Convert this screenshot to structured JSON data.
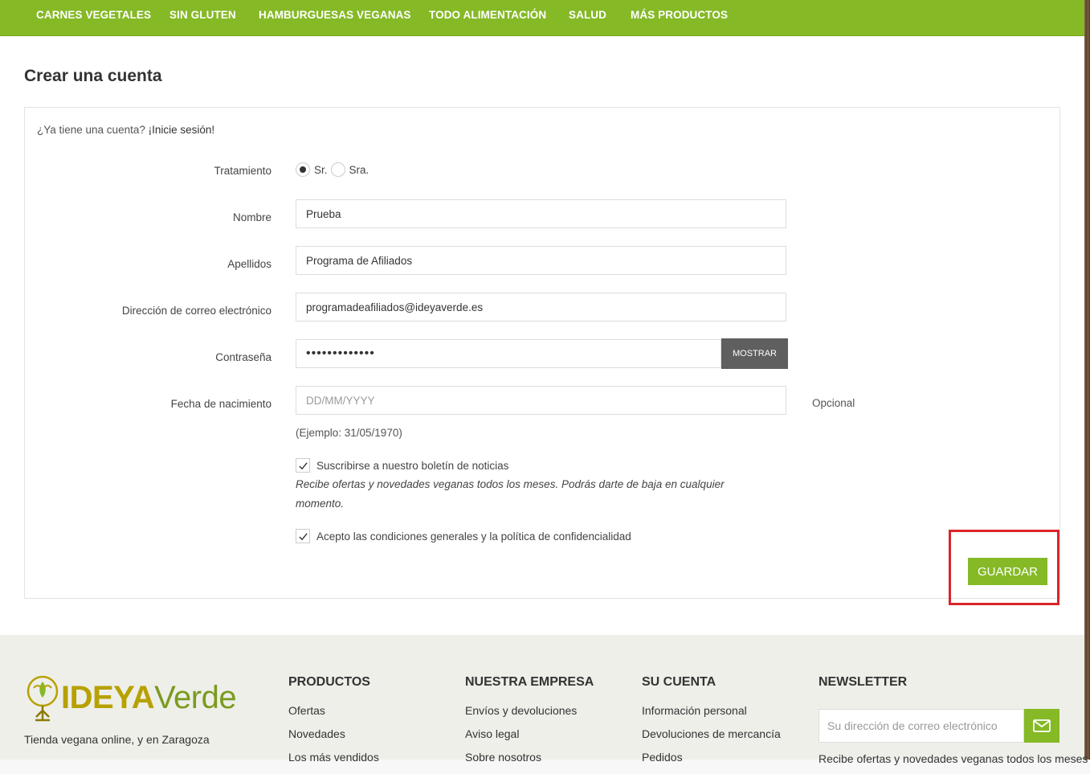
{
  "nav": {
    "items": [
      "CARNES VEGETALES",
      "SIN GLUTEN",
      "HAMBURGUESAS VEGANAS",
      "TODO ALIMENTACIÓN",
      "SALUD",
      "MÁS PRODUCTOS"
    ]
  },
  "page": {
    "title": "Crear una cuenta"
  },
  "form": {
    "login_prompt": "¿Ya tiene una cuenta?",
    "login_link": "¡Inicie sesión!",
    "gender": {
      "label": "Tratamiento",
      "options": [
        "Sr.",
        "Sra."
      ],
      "selected": "Sr."
    },
    "first_name": {
      "label": "Nombre",
      "value": "Prueba"
    },
    "last_name": {
      "label": "Apellidos",
      "value": "Programa de Afiliados"
    },
    "email": {
      "label": "Dirección de correo electrónico",
      "value": "programadeafiliados@ideyaverde.es"
    },
    "password": {
      "label": "Contraseña",
      "value": "•••••••••••••",
      "show_button": "MOSTRAR"
    },
    "birthday": {
      "label": "Fecha de nacimiento",
      "placeholder": "DD/MM/YYYY",
      "optional": "Opcional",
      "hint": "(Ejemplo: 31/05/1970)"
    },
    "newsletter": {
      "label": "Suscribirse a nuestro boletín de noticias",
      "checked": true,
      "description": "Recibe ofertas y novedades veganas todos los meses. Podrás darte de baja en cualquier momento."
    },
    "terms": {
      "label": "Acepto las condiciones generales y la política de confidencialidad",
      "checked": true
    },
    "save_button": "GUARDAR"
  },
  "footer": {
    "logo": {
      "part1": "IDEYA",
      "part2": "Verde"
    },
    "tagline": "Tienda vegana online, y en Zaragoza",
    "columns": [
      {
        "title": "PRODUCTOS",
        "links": [
          "Ofertas",
          "Novedades",
          "Los más vendidos"
        ]
      },
      {
        "title": "NUESTRA EMPRESA",
        "links": [
          "Envíos y devoluciones",
          "Aviso legal",
          "Sobre nosotros"
        ]
      },
      {
        "title": "SU CUENTA",
        "links": [
          "Información personal",
          "Devoluciones de mercancía",
          "Pedidos"
        ]
      }
    ],
    "newsletter": {
      "title": "NEWSLETTER",
      "placeholder": "Su dirección de correo electrónico",
      "description": "Recibe ofertas y novedades veganas todos los meses"
    }
  },
  "colors": {
    "brand_green": "#85b926",
    "highlight_red": "#d9252b",
    "dark_button": "#5f5f5f"
  }
}
